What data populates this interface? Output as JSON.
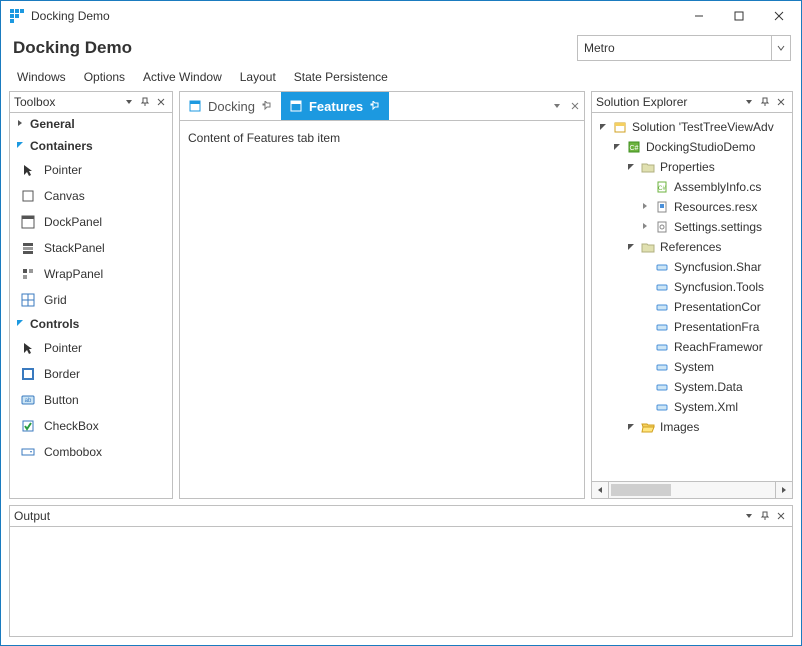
{
  "titlebar": {
    "title": "Docking Demo"
  },
  "header": {
    "title": "Docking Demo",
    "theme_selected": "Metro"
  },
  "menu": [
    "Windows",
    "Options",
    "Active Window",
    "Layout",
    "State Persistence"
  ],
  "toolbox": {
    "title": "Toolbox",
    "groups": [
      {
        "label": "General",
        "expanded": false,
        "accent": false
      },
      {
        "label": "Containers",
        "expanded": true,
        "accent": true,
        "items": [
          {
            "icon": "pointer",
            "label": "Pointer"
          },
          {
            "icon": "canvas",
            "label": "Canvas"
          },
          {
            "icon": "dockpanel",
            "label": "DockPanel"
          },
          {
            "icon": "stackpanel",
            "label": "StackPanel"
          },
          {
            "icon": "wrappanel",
            "label": "WrapPanel"
          },
          {
            "icon": "grid",
            "label": "Grid"
          }
        ]
      },
      {
        "label": "Controls",
        "expanded": true,
        "accent": true,
        "items": [
          {
            "icon": "pointer",
            "label": "Pointer"
          },
          {
            "icon": "border",
            "label": "Border"
          },
          {
            "icon": "button",
            "label": "Button"
          },
          {
            "icon": "checkbox",
            "label": "CheckBox"
          },
          {
            "icon": "combobox",
            "label": "Combobox"
          }
        ]
      }
    ]
  },
  "center": {
    "tabs": [
      {
        "label": "Docking",
        "active": false
      },
      {
        "label": "Features",
        "active": true
      }
    ],
    "content": "Content of Features tab item"
  },
  "solution_explorer": {
    "title": "Solution Explorer",
    "tree": [
      {
        "d": 0,
        "arrow": "open",
        "icon": "solution",
        "label": "Solution 'TestTreeViewAdv"
      },
      {
        "d": 1,
        "arrow": "open",
        "icon": "csproj",
        "label": "DockingStudioDemo"
      },
      {
        "d": 2,
        "arrow": "open",
        "icon": "folder",
        "label": "Properties"
      },
      {
        "d": 3,
        "arrow": "none",
        "icon": "csfile",
        "label": "AssemblyInfo.cs"
      },
      {
        "d": 3,
        "arrow": "closed",
        "icon": "resx",
        "label": "Resources.resx"
      },
      {
        "d": 3,
        "arrow": "closed",
        "icon": "settings",
        "label": "Settings.settings"
      },
      {
        "d": 2,
        "arrow": "open",
        "icon": "folder",
        "label": "References"
      },
      {
        "d": 3,
        "arrow": "none",
        "icon": "ref",
        "label": "Syncfusion.Shar"
      },
      {
        "d": 3,
        "arrow": "none",
        "icon": "ref",
        "label": "Syncfusion.Tools"
      },
      {
        "d": 3,
        "arrow": "none",
        "icon": "ref",
        "label": "PresentationCor"
      },
      {
        "d": 3,
        "arrow": "none",
        "icon": "ref",
        "label": "PresentationFra"
      },
      {
        "d": 3,
        "arrow": "none",
        "icon": "ref",
        "label": "ReachFramewor"
      },
      {
        "d": 3,
        "arrow": "none",
        "icon": "ref",
        "label": "System"
      },
      {
        "d": 3,
        "arrow": "none",
        "icon": "ref",
        "label": "System.Data"
      },
      {
        "d": 3,
        "arrow": "none",
        "icon": "ref",
        "label": "System.Xml"
      },
      {
        "d": 2,
        "arrow": "open",
        "icon": "folder-open",
        "label": "Images"
      }
    ]
  },
  "output": {
    "title": "Output"
  },
  "colors": {
    "accent": "#1c99e0"
  }
}
